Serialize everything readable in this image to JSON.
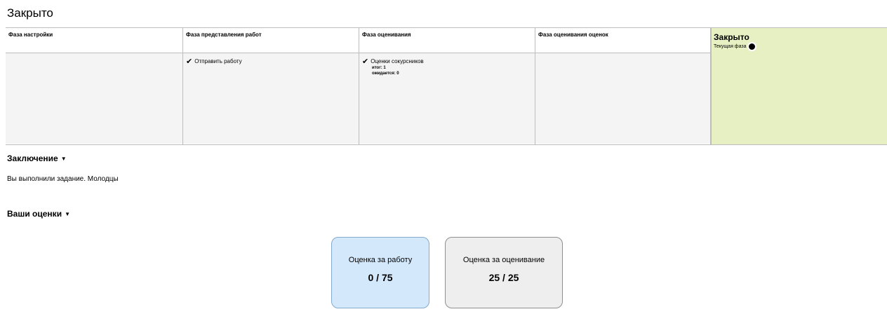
{
  "page": {
    "title": "Закрыто"
  },
  "phases": [
    {
      "title": "Фаза настройки",
      "tasks": []
    },
    {
      "title": "Фаза представления работ",
      "tasks": [
        {
          "label": "Отправить работу",
          "done": true
        }
      ]
    },
    {
      "title": "Фаза оценивания",
      "tasks": [
        {
          "label": "Оценки сокурсников",
          "done": true,
          "info": [
            "итог: 1",
            "ожидается: 0"
          ]
        }
      ]
    },
    {
      "title": "Фаза оценивания оценок",
      "tasks": []
    }
  ],
  "current_phase": {
    "title": "Закрыто",
    "label": "Текущая фаза"
  },
  "conclusion": {
    "heading": "Заключение",
    "text": "Вы выполнили задание. Молодцы"
  },
  "grades": {
    "heading": "Ваши оценки",
    "submission": {
      "label": "Оценка за работу",
      "value": "0 / 75"
    },
    "assessment": {
      "label": "Оценка за оценивание",
      "value": "25 / 25"
    }
  },
  "icons": {
    "check": "check-icon",
    "caret": "caret-down-icon",
    "current": "current-phase-dot-icon"
  }
}
